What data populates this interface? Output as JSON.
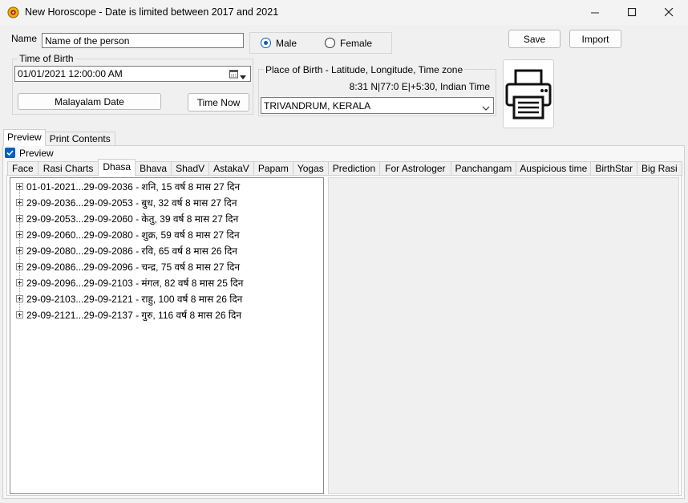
{
  "window": {
    "title": "New Horoscope - Date is limited between 2017 and 2021",
    "icon": "sun-wheel-icon",
    "controls": [
      "minimize-icon",
      "maximize-icon",
      "close-icon"
    ]
  },
  "form": {
    "name_label": "Name",
    "name_value": "Name of the person",
    "gender": {
      "male_label": "Male",
      "female_label": "Female",
      "selected": "male"
    },
    "save_label": "Save",
    "import_label": "Import",
    "time_of_birth": {
      "title": "Time of Birth",
      "value": "01/01/2021  12:00:00 AM",
      "malayalam_date_label": "Malayalam Date",
      "time_now_label": "Time Now"
    },
    "place_of_birth": {
      "title": "Place of Birth - Latitude, Longitude, Time zone",
      "coords": "8:31 N|77:0 E|+5:30, Indian Time",
      "place": "TRIVANDRUM, KERALA"
    },
    "print_icon": "printer-icon"
  },
  "outer_tabs": [
    {
      "label": "Preview",
      "active": true
    },
    {
      "label": "Print Contents",
      "active": false
    }
  ],
  "preview_checkbox": {
    "label": "Preview",
    "checked": true
  },
  "inner_tabs": [
    {
      "label": "Face",
      "active": false
    },
    {
      "label": "Rasi Charts",
      "active": false
    },
    {
      "label": "Dhasa",
      "active": true
    },
    {
      "label": "Bhava",
      "active": false
    },
    {
      "label": "ShadV",
      "active": false
    },
    {
      "label": "AstakaV",
      "active": false
    },
    {
      "label": "Papam",
      "active": false
    },
    {
      "label": "Yogas",
      "active": false
    },
    {
      "label": "Prediction",
      "active": false
    },
    {
      "label": "For Astrologer",
      "active": false
    },
    {
      "label": "Panchangam",
      "active": false
    },
    {
      "label": "Auspicious time",
      "active": false
    },
    {
      "label": "BirthStar",
      "active": false
    },
    {
      "label": "Big Rasi",
      "active": false
    }
  ],
  "dhasa_tree": [
    "01-01-2021...29-09-2036 - शनि, 15 वर्ष 8 मास 27 दिन",
    "29-09-2036...29-09-2053 - बुध, 32 वर्ष 8 मास 27 दिन",
    "29-09-2053...29-09-2060 - केतु, 39 वर्ष 8 मास 27 दिन",
    "29-09-2060...29-09-2080 - शुक्र, 59 वर्ष 8 मास 27 दिन",
    "29-09-2080...29-09-2086 - रवि, 65 वर्ष 8 मास 26 दिन",
    "29-09-2086...29-09-2096 - चन्द्र, 75 वर्ष 8 मास 27 दिन",
    "29-09-2096...29-09-2103 - मंगल, 82 वर्ष 8 मास 25 दिन",
    "29-09-2103...29-09-2121 - राहु, 100 वर्ष 8 मास 26 दिन",
    "29-09-2121...29-09-2137 - गुरु, 116 वर्ष 8 मास 26 दिन"
  ],
  "colors": {
    "accent": "#0a5fbf",
    "panel_bg": "#f0f0f0",
    "content_bg": "#ffffff"
  }
}
